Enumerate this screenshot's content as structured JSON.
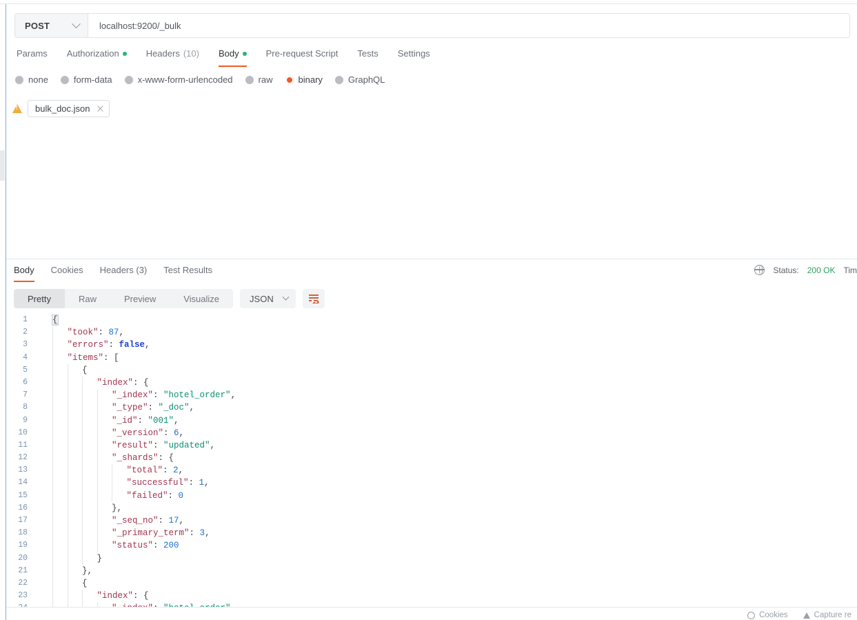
{
  "request": {
    "method": "POST",
    "url": "localhost:9200/_bulk",
    "tabs": [
      {
        "label": "Params",
        "active": false,
        "dot": false,
        "count": ""
      },
      {
        "label": "Authorization",
        "active": false,
        "dot": true,
        "count": ""
      },
      {
        "label": "Headers",
        "active": false,
        "dot": false,
        "count": "(10)"
      },
      {
        "label": "Body",
        "active": true,
        "dot": true,
        "count": ""
      },
      {
        "label": "Pre-request Script",
        "active": false,
        "dot": false,
        "count": ""
      },
      {
        "label": "Tests",
        "active": false,
        "dot": false,
        "count": ""
      },
      {
        "label": "Settings",
        "active": false,
        "dot": false,
        "count": ""
      }
    ],
    "body_types": [
      {
        "label": "none",
        "selected": false
      },
      {
        "label": "form-data",
        "selected": false
      },
      {
        "label": "x-www-form-urlencoded",
        "selected": false
      },
      {
        "label": "raw",
        "selected": false
      },
      {
        "label": "binary",
        "selected": true
      },
      {
        "label": "GraphQL",
        "selected": false
      }
    ],
    "file": {
      "name": "bulk_doc.json",
      "warning_icon": "warning-triangle-icon",
      "remove_icon": "close-icon"
    }
  },
  "response": {
    "tabs": [
      {
        "label": "Body",
        "active": true
      },
      {
        "label": "Cookies",
        "active": false
      },
      {
        "label": "Headers (3)",
        "active": false
      },
      {
        "label": "Test Results",
        "active": false
      }
    ],
    "status": {
      "globe_icon": "globe-icon",
      "status_label": "Status:",
      "status_value": "200 OK",
      "status_color": "#29a05e",
      "time_label_clipped": "Tim"
    },
    "view_modes": [
      {
        "label": "Pretty",
        "active": true
      },
      {
        "label": "Raw",
        "active": false
      },
      {
        "label": "Preview",
        "active": false
      },
      {
        "label": "Visualize",
        "active": false
      }
    ],
    "format": {
      "value": "JSON",
      "chevron_icon": "chevron-down-icon"
    },
    "wrap_icon": "wrap-lines-icon"
  },
  "code": {
    "lines": [
      {
        "n": 1,
        "indent": 0,
        "guides": 0,
        "tokens": [
          {
            "t": "pun",
            "v": "{",
            "hl": true
          }
        ]
      },
      {
        "n": 2,
        "indent": 1,
        "guides": 1,
        "tokens": [
          {
            "t": "key",
            "v": "\"took\""
          },
          {
            "t": "pun",
            "v": ": "
          },
          {
            "t": "num",
            "v": "87"
          },
          {
            "t": "pun",
            "v": ","
          }
        ]
      },
      {
        "n": 3,
        "indent": 1,
        "guides": 1,
        "tokens": [
          {
            "t": "key",
            "v": "\"errors\""
          },
          {
            "t": "pun",
            "v": ": "
          },
          {
            "t": "bool",
            "v": "false"
          },
          {
            "t": "pun",
            "v": ","
          }
        ]
      },
      {
        "n": 4,
        "indent": 1,
        "guides": 1,
        "tokens": [
          {
            "t": "key",
            "v": "\"items\""
          },
          {
            "t": "pun",
            "v": ": ["
          }
        ]
      },
      {
        "n": 5,
        "indent": 2,
        "guides": 2,
        "tokens": [
          {
            "t": "pun",
            "v": "{"
          }
        ]
      },
      {
        "n": 6,
        "indent": 3,
        "guides": 3,
        "tokens": [
          {
            "t": "key",
            "v": "\"index\""
          },
          {
            "t": "pun",
            "v": ": {"
          }
        ]
      },
      {
        "n": 7,
        "indent": 4,
        "guides": 4,
        "tokens": [
          {
            "t": "key",
            "v": "\"_index\""
          },
          {
            "t": "pun",
            "v": ": "
          },
          {
            "t": "str",
            "v": "\"hotel_order\""
          },
          {
            "t": "pun",
            "v": ","
          }
        ]
      },
      {
        "n": 8,
        "indent": 4,
        "guides": 4,
        "tokens": [
          {
            "t": "key",
            "v": "\"_type\""
          },
          {
            "t": "pun",
            "v": ": "
          },
          {
            "t": "str",
            "v": "\"_doc\""
          },
          {
            "t": "pun",
            "v": ","
          }
        ]
      },
      {
        "n": 9,
        "indent": 4,
        "guides": 4,
        "tokens": [
          {
            "t": "key",
            "v": "\"_id\""
          },
          {
            "t": "pun",
            "v": ": "
          },
          {
            "t": "str",
            "v": "\"001\""
          },
          {
            "t": "pun",
            "v": ","
          }
        ]
      },
      {
        "n": 10,
        "indent": 4,
        "guides": 4,
        "tokens": [
          {
            "t": "key",
            "v": "\"_version\""
          },
          {
            "t": "pun",
            "v": ": "
          },
          {
            "t": "num",
            "v": "6"
          },
          {
            "t": "pun",
            "v": ","
          }
        ]
      },
      {
        "n": 11,
        "indent": 4,
        "guides": 4,
        "tokens": [
          {
            "t": "key",
            "v": "\"result\""
          },
          {
            "t": "pun",
            "v": ": "
          },
          {
            "t": "str",
            "v": "\"updated\""
          },
          {
            "t": "pun",
            "v": ","
          }
        ]
      },
      {
        "n": 12,
        "indent": 4,
        "guides": 4,
        "tokens": [
          {
            "t": "key",
            "v": "\"_shards\""
          },
          {
            "t": "pun",
            "v": ": {"
          }
        ]
      },
      {
        "n": 13,
        "indent": 5,
        "guides": 5,
        "tokens": [
          {
            "t": "key",
            "v": "\"total\""
          },
          {
            "t": "pun",
            "v": ": "
          },
          {
            "t": "num",
            "v": "2"
          },
          {
            "t": "pun",
            "v": ","
          }
        ]
      },
      {
        "n": 14,
        "indent": 5,
        "guides": 5,
        "tokens": [
          {
            "t": "key",
            "v": "\"successful\""
          },
          {
            "t": "pun",
            "v": ": "
          },
          {
            "t": "num",
            "v": "1"
          },
          {
            "t": "pun",
            "v": ","
          }
        ]
      },
      {
        "n": 15,
        "indent": 5,
        "guides": 5,
        "tokens": [
          {
            "t": "key",
            "v": "\"failed\""
          },
          {
            "t": "pun",
            "v": ": "
          },
          {
            "t": "num",
            "v": "0"
          }
        ]
      },
      {
        "n": 16,
        "indent": 4,
        "guides": 4,
        "tokens": [
          {
            "t": "pun",
            "v": "},"
          }
        ]
      },
      {
        "n": 17,
        "indent": 4,
        "guides": 4,
        "tokens": [
          {
            "t": "key",
            "v": "\"_seq_no\""
          },
          {
            "t": "pun",
            "v": ": "
          },
          {
            "t": "num",
            "v": "17"
          },
          {
            "t": "pun",
            "v": ","
          }
        ]
      },
      {
        "n": 18,
        "indent": 4,
        "guides": 4,
        "tokens": [
          {
            "t": "key",
            "v": "\"_primary_term\""
          },
          {
            "t": "pun",
            "v": ": "
          },
          {
            "t": "num",
            "v": "3"
          },
          {
            "t": "pun",
            "v": ","
          }
        ]
      },
      {
        "n": 19,
        "indent": 4,
        "guides": 4,
        "tokens": [
          {
            "t": "key",
            "v": "\"status\""
          },
          {
            "t": "pun",
            "v": ": "
          },
          {
            "t": "num",
            "v": "200"
          }
        ]
      },
      {
        "n": 20,
        "indent": 3,
        "guides": 3,
        "tokens": [
          {
            "t": "pun",
            "v": "}"
          }
        ]
      },
      {
        "n": 21,
        "indent": 2,
        "guides": 2,
        "tokens": [
          {
            "t": "pun",
            "v": "},"
          }
        ]
      },
      {
        "n": 22,
        "indent": 2,
        "guides": 2,
        "tokens": [
          {
            "t": "pun",
            "v": "{"
          }
        ]
      },
      {
        "n": 23,
        "indent": 3,
        "guides": 3,
        "tokens": [
          {
            "t": "key",
            "v": "\"index\""
          },
          {
            "t": "pun",
            "v": ": {"
          }
        ]
      },
      {
        "n": 24,
        "indent": 4,
        "guides": 4,
        "tokens": [
          {
            "t": "key",
            "v": "\"_index\""
          },
          {
            "t": "pun",
            "v": ": "
          },
          {
            "t": "str",
            "v": "\"hotel_order\""
          }
        ]
      }
    ]
  },
  "footer": {
    "items": [
      {
        "icon": "cookie-icon",
        "label": "Cookies"
      },
      {
        "icon": "capture-icon",
        "label": "Capture re"
      }
    ]
  }
}
